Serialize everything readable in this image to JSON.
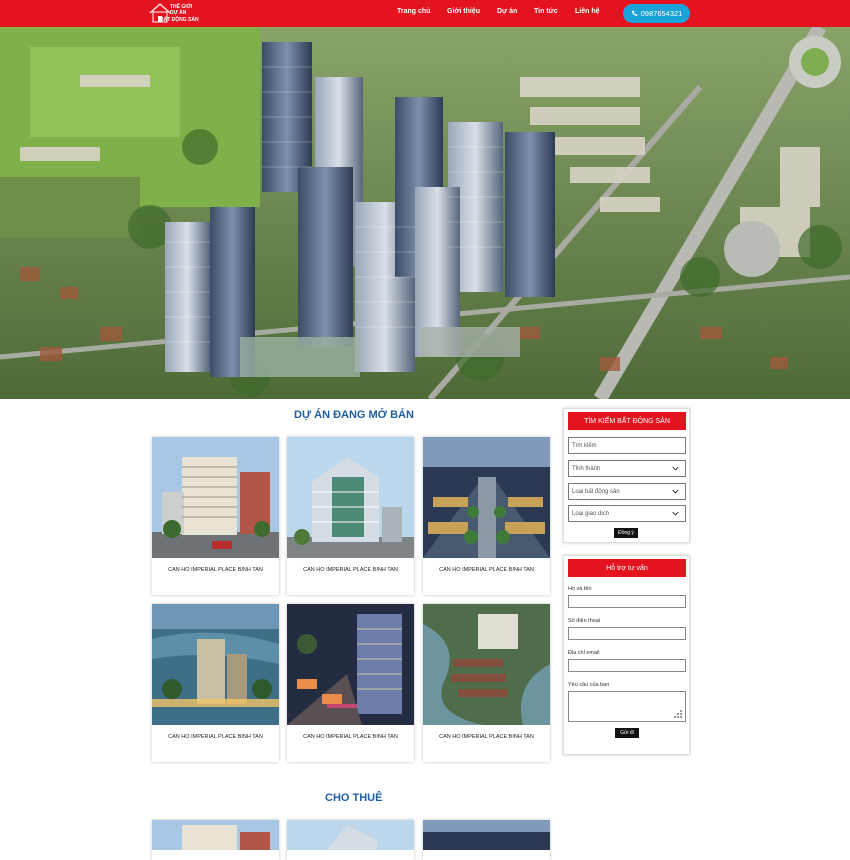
{
  "header": {
    "logo": {
      "line1": "THẾ GIỚI",
      "line2": "DỰ ÁN",
      "line3": "BẤT ĐỘNG SẢN"
    },
    "nav": [
      "Trang chủ",
      "Giới thiệu",
      "Dự án",
      "Tin tức",
      "Liên hệ"
    ],
    "phone": "0987654321",
    "colors": {
      "brand": "#e3141f",
      "phone_button": "#1aa3d9"
    }
  },
  "projects_section": {
    "title": "DỰ ÁN ĐANG MỞ BÁN",
    "cards": [
      {
        "title": "CAN HO IMPERIAL PLACE BINH TAN"
      },
      {
        "title": "CAN HO IMPERIAL PLACE BINH TAN"
      },
      {
        "title": "CAN HO IMPERIAL PLACE BINH TAN"
      },
      {
        "title": "CAN HO IMPERIAL PLACE BINH TAN"
      },
      {
        "title": "CAN HO IMPERIAL PLACE BINH TAN"
      },
      {
        "title": "CAN HO IMPERIAL PLACE BINH TAN"
      }
    ]
  },
  "rent_section": {
    "title": "CHO THUÊ"
  },
  "search_panel": {
    "title": "TÌM KIẾM BẤT ĐỘNG SẢN",
    "search_placeholder": "Tìm kiếm",
    "selects": [
      "Tỉnh thành",
      "Loại bất động sản",
      "Loại giao dịch"
    ],
    "submit": "Đồng ý"
  },
  "support_panel": {
    "title": "Hỗ trợ tư vấn",
    "fields": [
      "Họ và tên",
      "Số điện thoại",
      "Địa chỉ email",
      "Yêu cầu của bạn"
    ],
    "submit": "Gửi đi"
  },
  "icons": {
    "phone": "phone-icon",
    "chevron": "chevron-down-icon",
    "resize": "resize-grip-icon"
  },
  "colors": {
    "section_title": "#1f5fa0"
  }
}
